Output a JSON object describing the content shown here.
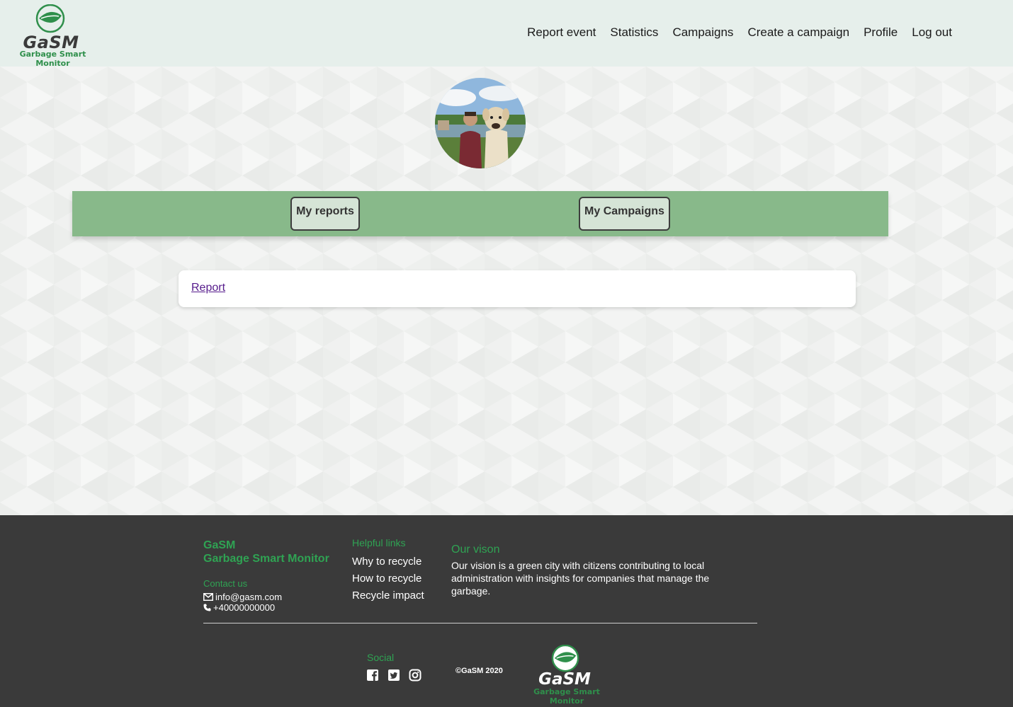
{
  "brand": {
    "logo_title": "GaSM",
    "logo_subtitle": "Garbage Smart Monitor"
  },
  "nav": {
    "items": [
      {
        "label": "Report event"
      },
      {
        "label": "Statistics"
      },
      {
        "label": "Campaigns"
      },
      {
        "label": "Create a campaign"
      },
      {
        "label": "Profile"
      },
      {
        "label": "Log out"
      }
    ]
  },
  "profile": {
    "tabs": {
      "reports_label": "My reports",
      "campaigns_label": "My Campaigns"
    },
    "reports": [
      {
        "link_text": "Report"
      }
    ]
  },
  "footer": {
    "brand_name": "GaSM",
    "brand_full": "Garbage Smart Monitor",
    "contact_heading": "Contact us",
    "email": "info@gasm.com",
    "phone": "+40000000000",
    "links_heading": "Helpful links",
    "links": [
      {
        "label": "Why to recycle"
      },
      {
        "label": "How to recycle"
      },
      {
        "label": "Recycle impact"
      }
    ],
    "vision_heading": "Our vison",
    "vision_text": "Our vision is a green city with citizens contributing to local administration with insights for companies that manage the garbage.",
    "social_heading": "Social",
    "social_icons": [
      "facebook-icon",
      "twitter-icon",
      "instagram-icon"
    ],
    "copyright": "©GaSM 2020"
  },
  "colors": {
    "header_bg": "#e6efeb",
    "accent_green": "#2fa353",
    "tabbar_green": "#88b98a",
    "footer_bg": "#3a3a3a"
  }
}
